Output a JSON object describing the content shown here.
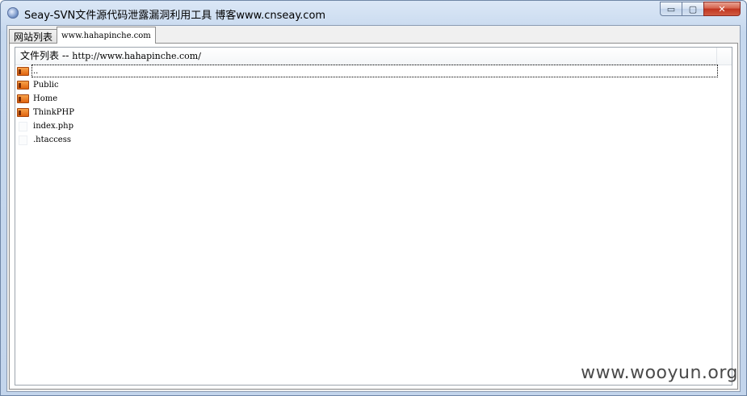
{
  "window": {
    "title": "Seay-SVN文件源代码泄露漏洞利用工具  博客www.cnseay.com",
    "controls": {
      "minimize": "▭",
      "maximize": "▢",
      "close": "✕"
    }
  },
  "tabs": [
    {
      "label": "网站列表",
      "active": false
    },
    {
      "label": "www.hahapinche.com",
      "active": true
    }
  ],
  "file_list": {
    "header_prefix": "文件列表 -- ",
    "header_path": "http://www.hahapinche.com/",
    "rows": [
      {
        "name": "..",
        "type": "folder"
      },
      {
        "name": "Public",
        "type": "folder"
      },
      {
        "name": "Home",
        "type": "folder"
      },
      {
        "name": "ThinkPHP",
        "type": "folder"
      },
      {
        "name": "index.php",
        "type": "file"
      },
      {
        "name": ".htaccess",
        "type": "file"
      }
    ]
  },
  "watermark": "www.wooyun.org",
  "colors": {
    "folder": "#e87a20",
    "close_button": "#c7402b",
    "title_bar": "#c6d8ee"
  }
}
